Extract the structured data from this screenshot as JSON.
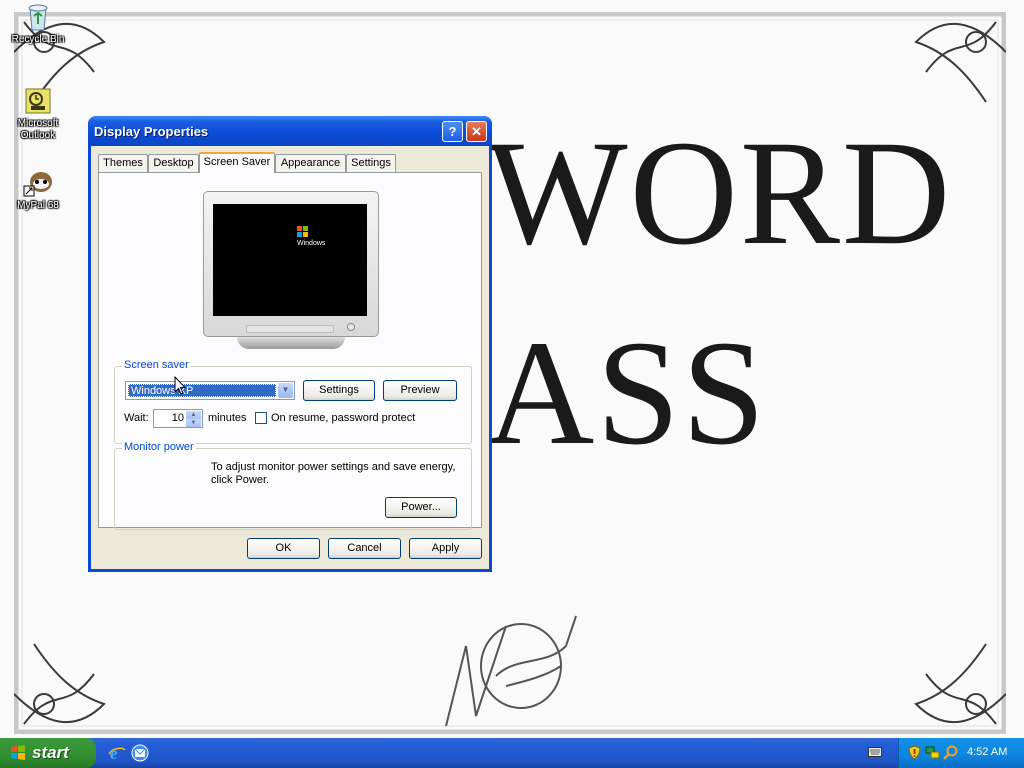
{
  "desktop": {
    "wallpaper_text_line1": "WORD",
    "wallpaper_text_line2": "ASS",
    "icons": [
      {
        "label": "Recycle Bin",
        "icon": "recycle-bin-icon"
      },
      {
        "label": "Microsoft Outlook",
        "icon": "outlook-icon"
      },
      {
        "label": "MyPal 68",
        "icon": "mypal-icon"
      }
    ]
  },
  "window": {
    "title": "Display Properties",
    "help_label": "?",
    "close_label": "✕",
    "tabs": [
      {
        "label": "Themes"
      },
      {
        "label": "Desktop"
      },
      {
        "label": "Screen Saver",
        "active": true
      },
      {
        "label": "Appearance"
      },
      {
        "label": "Settings"
      }
    ],
    "preview_logo_text": "Windows",
    "screen_saver": {
      "legend": "Screen saver",
      "selected": "Windows XP",
      "settings_label": "Settings",
      "preview_label": "Preview",
      "wait_label": "Wait:",
      "wait_value": "10",
      "minutes_label": "minutes",
      "password_label": "On resume, password protect"
    },
    "monitor_power": {
      "legend": "Monitor power",
      "description": "To adjust monitor power settings and save energy, click Power.",
      "power_label": "Power..."
    },
    "ok_label": "OK",
    "cancel_label": "Cancel",
    "apply_label": "Apply"
  },
  "taskbar": {
    "start_label": "start",
    "clock": "4:52 AM"
  },
  "colors": {
    "title_bar": "#0b4ad4",
    "taskbar": "#245edb",
    "start_button": "#2f8e2f",
    "selection": "#316ac5",
    "group_legend": "#0046d5"
  }
}
